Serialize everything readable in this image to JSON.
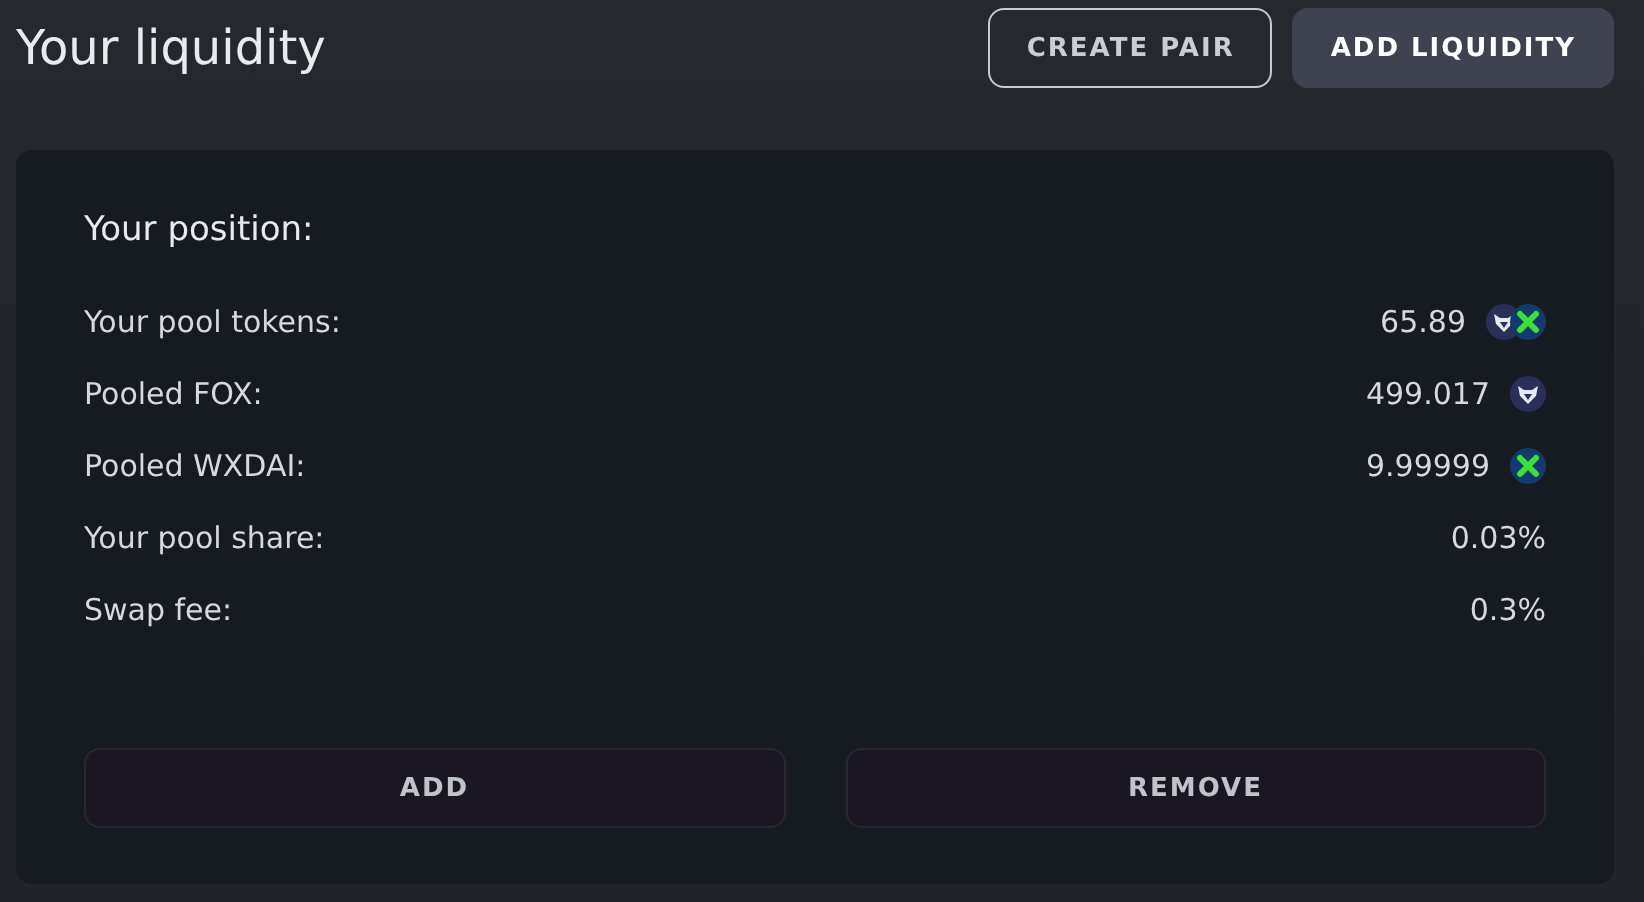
{
  "header": {
    "title": "Your liquidity",
    "buttons": [
      {
        "label": "CREATE PAIR",
        "kind": "outline"
      },
      {
        "label": "ADD LIQUIDITY",
        "kind": "filled"
      }
    ]
  },
  "position": {
    "title": "Your position:",
    "rows": [
      {
        "label": "Your pool tokens:",
        "value": "65.89",
        "kind": "pair"
      },
      {
        "label": "Pooled FOX:",
        "value": "499.017",
        "kind": "fox"
      },
      {
        "label": "Pooled WXDAI:",
        "value": "9.99999",
        "kind": "xdai"
      },
      {
        "label": "Your pool share:",
        "value": "0.03%",
        "kind": "plain"
      },
      {
        "label": "Swap fee:",
        "value": "0.3%",
        "kind": "plain"
      }
    ],
    "actions": [
      "ADD",
      "REMOVE"
    ]
  }
}
